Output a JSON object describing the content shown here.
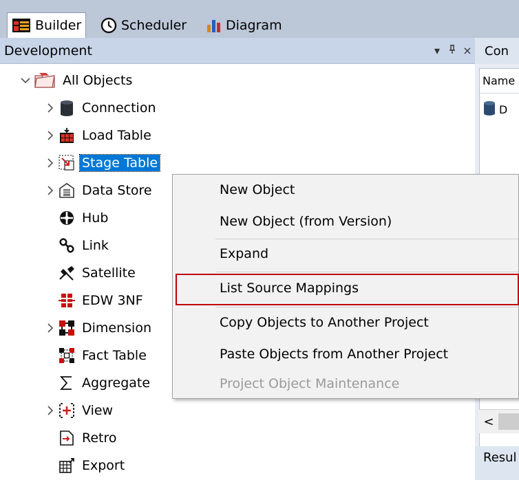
{
  "tabs": [
    {
      "label": "Builder",
      "icon": "builder-icon"
    },
    {
      "label": "Scheduler",
      "icon": "clock-icon"
    },
    {
      "label": "Diagram",
      "icon": "bar-chart-icon"
    }
  ],
  "left_panel": {
    "title": "Development",
    "controls": {
      "dropdown": "▾",
      "pin": "ᚚ",
      "close": "×"
    }
  },
  "tree": [
    {
      "label": "All Objects",
      "icon": "folder-icon"
    },
    {
      "label": "Connection",
      "icon": "database-icon"
    },
    {
      "label": "Load Table",
      "icon": "load-table-icon"
    },
    {
      "label": "Stage Table",
      "icon": "stage-table-icon"
    },
    {
      "label": "Data Store",
      "icon": "data-store-icon"
    },
    {
      "label": "Hub",
      "icon": "hub-icon"
    },
    {
      "label": "Link",
      "icon": "link-icon"
    },
    {
      "label": "Satellite",
      "icon": "satellite-icon"
    },
    {
      "label": "EDW 3NF",
      "icon": "edw-icon"
    },
    {
      "label": "Dimension",
      "icon": "dimension-icon"
    },
    {
      "label": "Fact Table",
      "icon": "fact-table-icon"
    },
    {
      "label": "Aggregate",
      "icon": "sigma-icon"
    },
    {
      "label": "View",
      "icon": "view-icon"
    },
    {
      "label": "Retro",
      "icon": "retro-icon"
    },
    {
      "label": "Export",
      "icon": "export-icon"
    }
  ],
  "context_menu": {
    "items": [
      {
        "label": "New Object",
        "disabled": false
      },
      {
        "label": "New Object (from Version)",
        "disabled": false
      },
      {
        "label": "Expand",
        "disabled": false
      },
      {
        "label": "List Source Mappings",
        "disabled": false
      },
      {
        "label": "Copy Objects to Another Project",
        "disabled": false
      },
      {
        "label": "Paste Objects from Another Project",
        "disabled": false
      },
      {
        "label": "Project Object Maintenance",
        "disabled": true
      }
    ]
  },
  "right_panel": {
    "tab_label": "Con",
    "column_header": "Name",
    "row_text": "D",
    "results_label": "Resul",
    "scroll_left": "<"
  },
  "colors": {
    "selection": "#0078d7",
    "highlight_box": "#c00000",
    "tab_strip": "#bcc7d8",
    "panel_header": "#c8d4e8"
  }
}
